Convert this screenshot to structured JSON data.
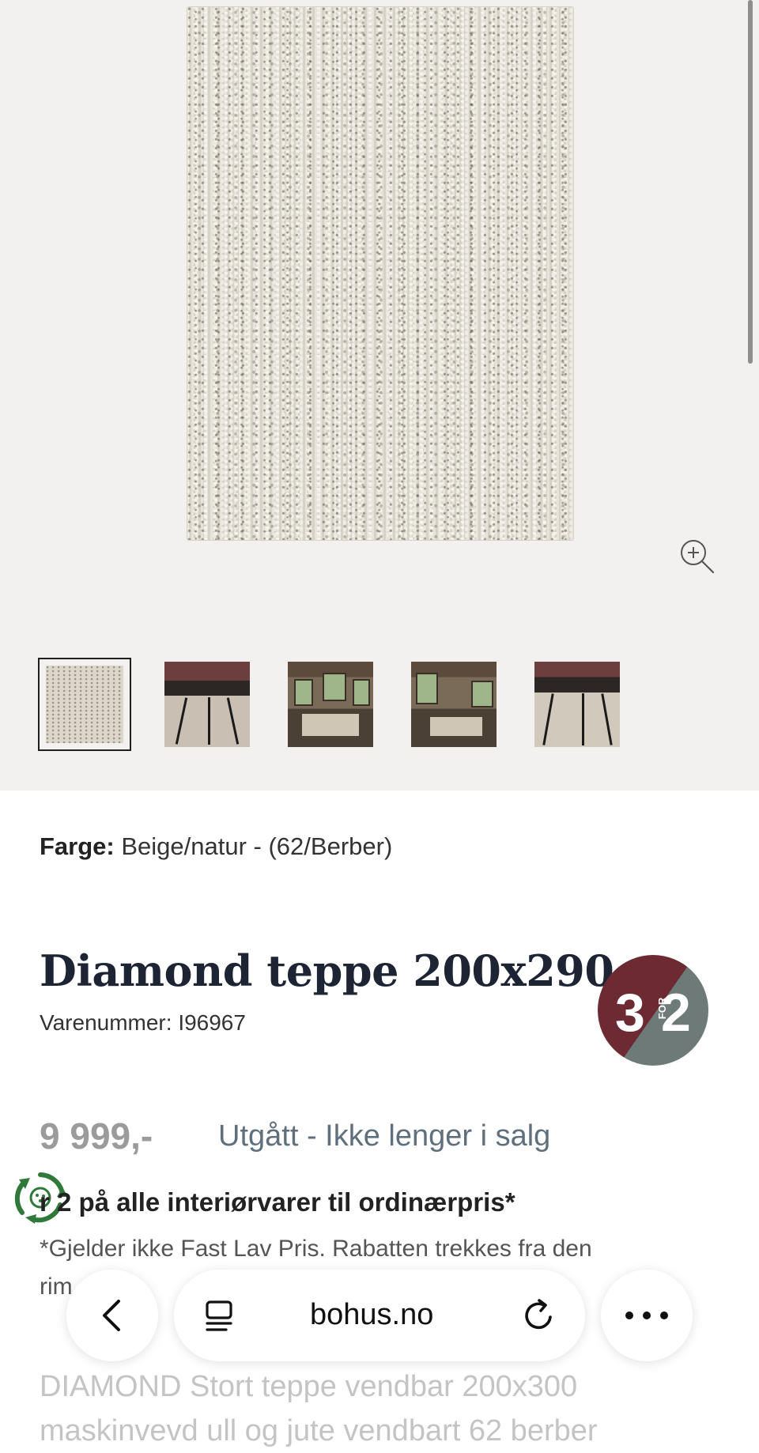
{
  "gallery": {
    "zoom_icon": "zoom-in-icon",
    "thumbnails": [
      {
        "name": "thumbnail-rug",
        "active": true
      },
      {
        "name": "thumbnail-side-tables",
        "active": false
      },
      {
        "name": "thumbnail-living-room",
        "active": false
      },
      {
        "name": "thumbnail-living-room-sofa",
        "active": false
      },
      {
        "name": "thumbnail-side-tables-closeup",
        "active": false
      }
    ]
  },
  "product": {
    "color_label": "Farge:",
    "color_value": "Beige/natur - (62/Berber)",
    "title": "Diamond teppe 200x290",
    "sku": "Varenummer: I96967",
    "badge": {
      "left": "3",
      "for": "FOR",
      "right": "2"
    },
    "price": "9 999,-",
    "status": "Utgått - Ikke lenger i salg",
    "promo": "r 2 på alle interiørvarer til ordinærpris*",
    "note_line1": "*Gjelder ikke Fast Lav Pris. Rabatten trekkes fra den",
    "note_line2": "rim",
    "description_line1": "DIAMOND Stort teppe vendbar 200x300",
    "description_line2": "maskinvevd ull og jute vendbart 62 berber"
  },
  "browser": {
    "url": "bohus.no",
    "icons": {
      "back": "chevron-left-icon",
      "tabs": "tabs-icon",
      "reload": "reload-icon",
      "more": "more-icon"
    }
  },
  "colors": {
    "title": "#1d2433",
    "status": "#5f6f7c",
    "badge_red": "#6d2a33",
    "badge_gray": "#6e7a78",
    "gallery_bg": "#f3f1ef",
    "eco_green": "#2f7a3a"
  }
}
